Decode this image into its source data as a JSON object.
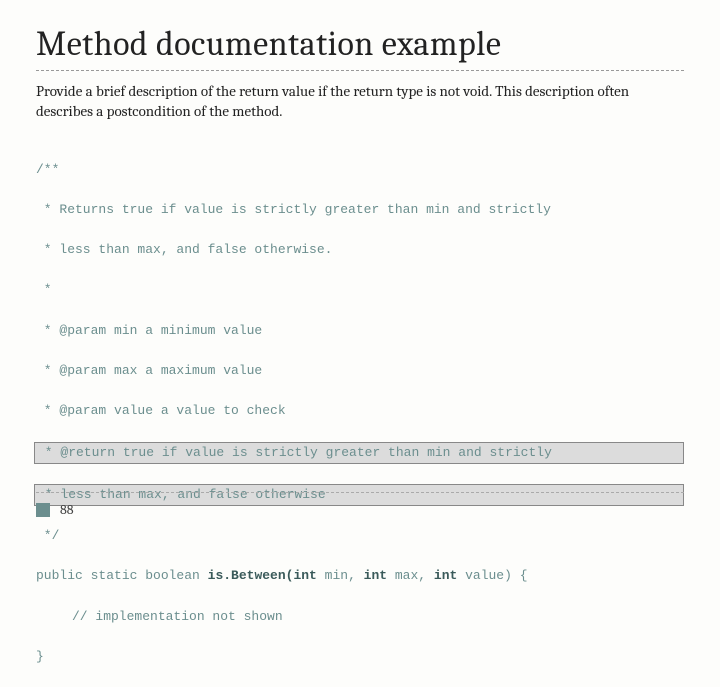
{
  "title": "Method documentation example",
  "description": "Provide a brief description of the return value if the return type is not void. This description often describes a postcondition of the method.",
  "code": {
    "l1": "/**",
    "l2": " * Returns true if value is strictly greater than min and strictly",
    "l3": " * less than max, and false otherwise.",
    "l4": " *",
    "l5": " * @param min a minimum value",
    "l6": " * @param max a maximum value",
    "l7": " * @param value a value to check",
    "l8": " * @return true if value is strictly greater than min and strictly",
    "l9": " * less than max, and false otherwise",
    "l10": " */",
    "l11_a": "public static boolean ",
    "l11_b": "is.Between(int",
    "l11_c": " min, ",
    "l11_d": "int",
    "l11_e": " max, ",
    "l11_f": "int",
    "l11_g": " value) {",
    "l12": "// implementation not shown",
    "l13": "}"
  },
  "page_number": "88"
}
